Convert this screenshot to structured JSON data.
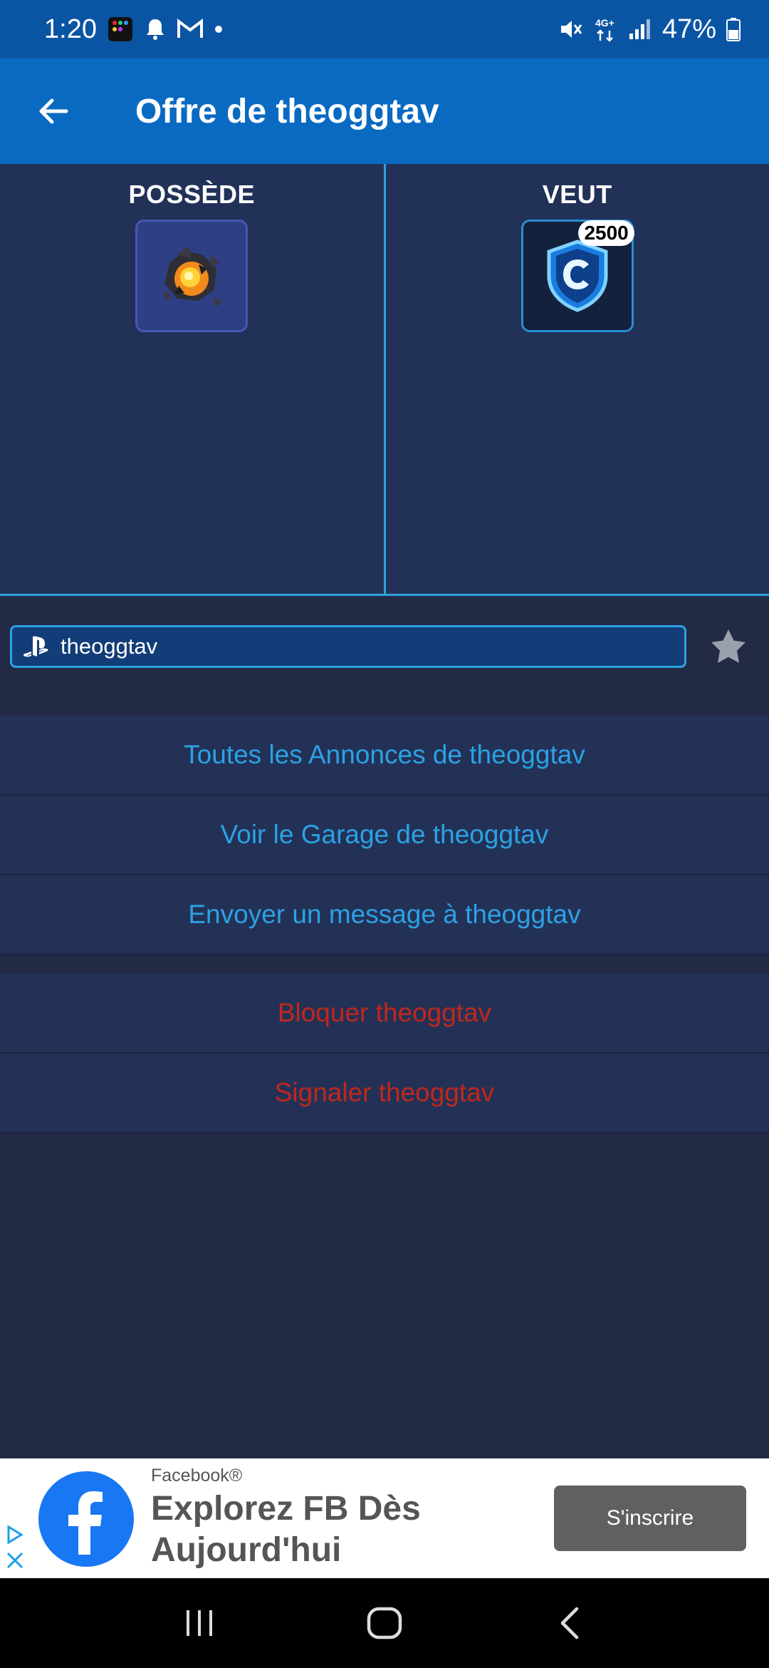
{
  "status_bar": {
    "time": "1:20",
    "battery": "47%",
    "network": "4G+"
  },
  "app_bar": {
    "title": "Offre de theoggtav"
  },
  "trade": {
    "has": {
      "title": "POSSÈDE",
      "item_icon": "explosion-icon"
    },
    "wants": {
      "title": "VEUT",
      "item_icon": "credits-icon",
      "quantity": "2500"
    }
  },
  "user": {
    "platform_icon": "playstation-icon",
    "name": "theoggtav"
  },
  "actions": {
    "all_listings": "Toutes les Annonces de theoggtav",
    "view_garage": "Voir le Garage de theoggtav",
    "send_message": "Envoyer un message à theoggtav",
    "block": "Bloquer theoggtav",
    "report": "Signaler theoggtav"
  },
  "ad": {
    "brand": "Facebook®",
    "headline": "Explorez FB Dès Aujourd'hui",
    "cta": "S'inscrire"
  },
  "colors": {
    "app_bar": "#0a6ac2",
    "status_bar": "#0a55a3",
    "background": "#222a45",
    "link_blue": "#2ba2e3",
    "danger_red": "#c0271c",
    "accent_border": "#2aa3e0"
  }
}
